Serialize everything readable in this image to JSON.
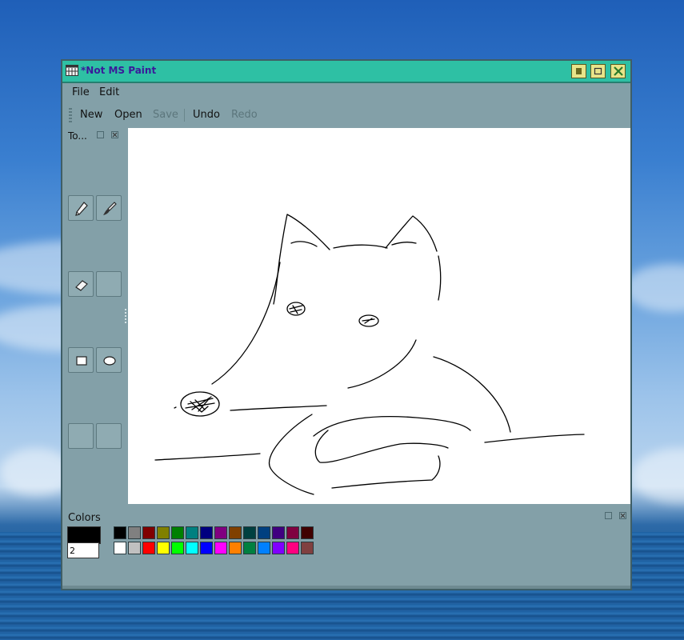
{
  "window": {
    "title": "*Not MS Paint",
    "accent": "#2ec0a4",
    "title_color": "#3a1a9a"
  },
  "menu": {
    "file_label": "File",
    "edit_label": "Edit"
  },
  "toolbar": {
    "new_label": "New",
    "open_label": "Open",
    "save_label": "Save",
    "undo_label": "Undo",
    "redo_label": "Redo",
    "disabled": [
      "Save",
      "Redo"
    ]
  },
  "tools_panel": {
    "title": "To...",
    "tools": [
      "pencil-icon",
      "brush-icon",
      "eraser-icon",
      "empty",
      "rectangle-icon",
      "ellipse-icon",
      "empty",
      "empty"
    ]
  },
  "colors_panel": {
    "title": "Colors",
    "primary_color": "#000000",
    "secondary_color": "#ffffff",
    "brush_size": "2",
    "palette_row1": [
      "#000000",
      "#808080",
      "#800000",
      "#808000",
      "#008000",
      "#008080",
      "#000080",
      "#800080",
      "#804000",
      "#004040",
      "#004080",
      "#400080",
      "#800040",
      "#400000"
    ],
    "palette_row2": [
      "#ffffff",
      "#c0c0c0",
      "#ff0000",
      "#ffff00",
      "#00ff00",
      "#00ffff",
      "#0000ff",
      "#ff00ff",
      "#ff8000",
      "#008040",
      "#0080ff",
      "#8000ff",
      "#ff0080",
      "#804040"
    ]
  }
}
